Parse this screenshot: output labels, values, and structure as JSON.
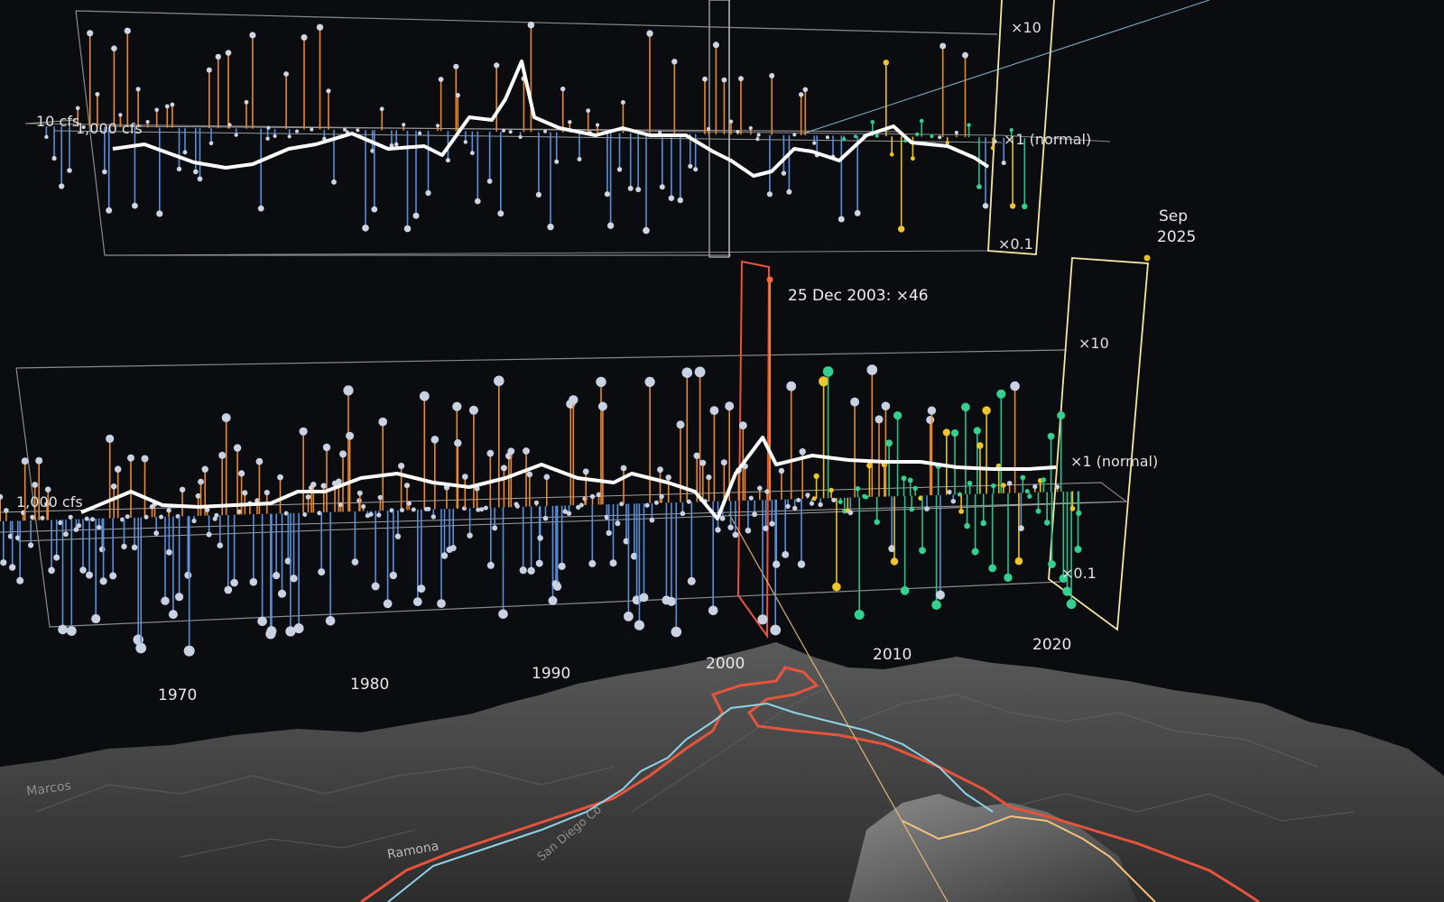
{
  "chart_data": [
    {
      "type": "scatter",
      "panel": "upper",
      "description_style": "lollipop stems from normal flow, values are ratio to normal (log scale)",
      "y_scale": "log",
      "y_ticks": [
        "×10",
        "×1 (normal)",
        "×0.1"
      ],
      "scale_labels": [
        "10 cfs",
        "1,000 cfs"
      ],
      "x_range": [
        1957,
        2026
      ],
      "y_range_ratio": [
        0.1,
        10
      ],
      "series_colors": {
        "above": "#e8892f",
        "below": "#5b8fd8",
        "recent_gold": "#e5c027",
        "recent_green": "#2fbf8a",
        "marker_current": "#ff6a3d"
      },
      "trend_color": "#ffffff"
    },
    {
      "type": "scatter",
      "panel": "lower",
      "y_scale": "log",
      "y_ticks": [
        "×10",
        "×1 (normal)",
        "×0.1"
      ],
      "scale_labels": [
        "1,000 cfs"
      ],
      "x_range": [
        1957,
        2026
      ],
      "x_ticks": [
        "1970",
        "1980",
        "1990",
        "2000",
        "2010",
        "2020"
      ],
      "highlight": {
        "label": "25 Dec 2003: ×46",
        "date": "2003-12-25",
        "ratio": 46
      },
      "end_label": {
        "line1": "Sep",
        "line2": "2025"
      },
      "series_colors": {
        "above": "#e8892f",
        "below": "#5b8fd8",
        "ball": "#c9d2e3",
        "recent_gold": "#e5c027",
        "recent_green": "#2fbf8a"
      },
      "trend_color": "#ffffff",
      "frame_color": "#f3e7a0",
      "highlight_color": "#e8543b"
    }
  ],
  "labels": {
    "upper_x10": "×10",
    "upper_x1": "×1 (normal)",
    "upper_x01": "×0.1",
    "upper_cfs_small": "10 cfs",
    "upper_cfs_big": "1,000 cfs",
    "lower_x10": "×10",
    "lower_x1": "×1 (normal)",
    "lower_x01": "×0.1",
    "lower_cfs": "1,000 cfs",
    "callout": "25 Dec 2003: ×46",
    "end_month": "Sep",
    "end_year": "2025",
    "year_1970": "1970",
    "year_1980": "1980",
    "year_1990": "1990",
    "year_2000": "2000",
    "year_2010": "2010",
    "year_2020": "2020"
  },
  "map": {
    "place_labels": [
      "Ramona",
      "Marcos",
      "San Diego Co"
    ],
    "terrain_color": "#4a4a4a",
    "route_colors": [
      "#e8543b",
      "#8fd3e8",
      "#f5c27a"
    ]
  }
}
